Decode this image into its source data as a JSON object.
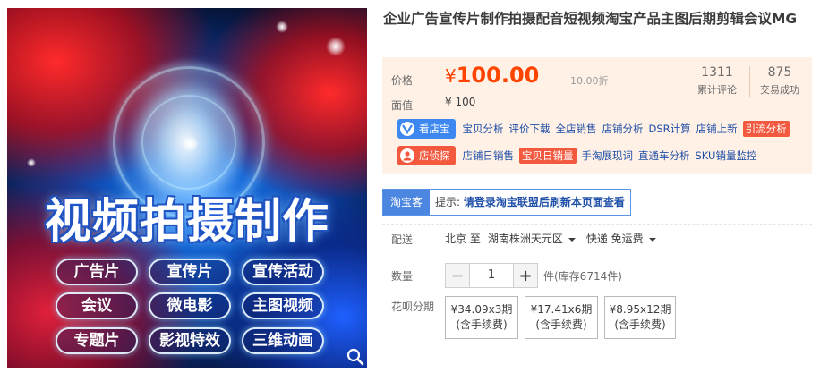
{
  "image": {
    "headline": "视频拍摄制作",
    "tags": [
      "广告片",
      "宣传片",
      "宣传活动",
      "会议",
      "微电影",
      "主图视频",
      "专题片",
      "影视特效",
      "三维动画"
    ]
  },
  "title": "企业广告宣传片制作拍摄配音短视频淘宝产品主图后期剪辑会议MG",
  "price": {
    "label": "价格",
    "currency": "¥",
    "value": "100.00",
    "discount": "10.00折",
    "face_label": "面值",
    "face_value": "¥ 100"
  },
  "stats": {
    "reviews_count": "1311",
    "reviews_label": "累计评论",
    "sales_count": "875",
    "sales_label": "交易成功"
  },
  "tools": {
    "row1_badge": "看店宝",
    "row1_links": [
      "宝贝分析",
      "评价下载",
      "全店销售",
      "店铺分析",
      "DSR计算",
      "店铺上新",
      "引流分析"
    ],
    "row2_badge": "店侦探",
    "row2_links": [
      "店铺日销售",
      "宝贝日销量",
      "手淘展现词",
      "直通车分析",
      "SKU销量监控"
    ]
  },
  "taobaoke": {
    "tag": "淘宝客",
    "tip_prefix": "提示: ",
    "tip_text": "请登录淘宝联盟后刷新本页面查看"
  },
  "delivery": {
    "label": "配送",
    "from": "北京 至",
    "to": "湖南株洲天元区",
    "method": "快递 免运费"
  },
  "quantity": {
    "label": "数量",
    "value": "1",
    "stock": "件(库存6714件)"
  },
  "installments": {
    "label": "花呗分期",
    "plans": [
      {
        "amount": "¥34.09x3期",
        "fee": "(含手续费)"
      },
      {
        "amount": "¥17.41x6期",
        "fee": "(含手续费)"
      },
      {
        "amount": "¥8.95x12期",
        "fee": "(含手续费)"
      }
    ]
  },
  "colors": {
    "price": "#ff4400",
    "price_panel_bg": "#fff1e6",
    "link": "#1f4fa8",
    "badge_blue": "#3d88f0",
    "badge_red": "#f2593f"
  }
}
